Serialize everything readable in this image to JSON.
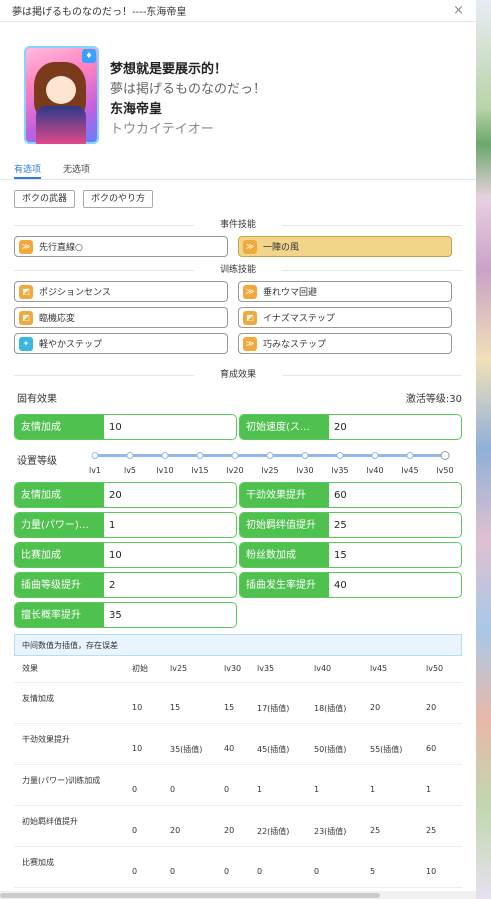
{
  "window": {
    "title": "夢は掲げるものなのだっ！----东海帝皇",
    "close": "×"
  },
  "card": {
    "badge": "♦"
  },
  "names": {
    "chinese_title": "梦想就是要展示的！",
    "japanese_title": "夢は掲げるものなのだっ！",
    "chinese_name": "东海帝皇",
    "japanese_name": "トウカイテイオー"
  },
  "tabs": [
    {
      "label": "有选项",
      "active": true
    },
    {
      "label": "无选项",
      "active": false
    }
  ],
  "options": [
    "ボクの武器",
    "ボクのやり方"
  ],
  "event_skills": {
    "header": "事件技能",
    "items": [
      {
        "label": "先行直線○",
        "style": "normal",
        "icon": "yellow"
      },
      {
        "label": "一陣の風",
        "style": "gold",
        "icon": "yellow"
      }
    ]
  },
  "training_skills": {
    "header": "训练技能",
    "items": [
      {
        "label": "ポジションセンス",
        "icon": "yellow"
      },
      {
        "label": "垂れウマ回避",
        "icon": "yellow"
      },
      {
        "label": "臨機応変",
        "icon": "yellow"
      },
      {
        "label": "イナズマステップ",
        "icon": "yellow"
      },
      {
        "label": "軽やかステップ",
        "icon": "blue"
      },
      {
        "label": "巧みなステップ",
        "icon": "yellow"
      }
    ]
  },
  "training_effects": {
    "header": "育成效果",
    "unique_label": "固有效果",
    "activation_level": "激活等级:30",
    "unique": [
      {
        "label": "友情加成",
        "value": "10"
      },
      {
        "label": "初始速度(ス…",
        "value": "20"
      }
    ],
    "level_label": "设置等级",
    "levels": [
      "lv1",
      "lv5",
      "lv10",
      "lv15",
      "lv20",
      "lv25",
      "lv30",
      "lv35",
      "lv40",
      "lv45",
      "lv50"
    ],
    "selected_level": "lv50",
    "stats": [
      {
        "label": "友情加成",
        "value": "20"
      },
      {
        "label": "干劲效果提升",
        "value": "60"
      },
      {
        "label": "力量(パワー)…",
        "value": "1"
      },
      {
        "label": "初始羁绊值提升",
        "value": "25"
      },
      {
        "label": "比赛加成",
        "value": "10"
      },
      {
        "label": "粉丝数加成",
        "value": "15"
      },
      {
        "label": "插曲等级提升",
        "value": "2"
      },
      {
        "label": "插曲发生率提升",
        "value": "40"
      },
      {
        "label": "擅长概率提升",
        "value": "35"
      }
    ]
  },
  "note": "中间数值为插值，存在误差",
  "table": {
    "headers": [
      "效果",
      "初始",
      "lv25",
      "lv30",
      "lv35",
      "lv40",
      "lv45",
      "lv50"
    ],
    "rows": [
      [
        "友情加成",
        "10",
        "15",
        "15",
        "17(插值)",
        "18(插值)",
        "20",
        "20"
      ],
      [
        "干劲效果提升",
        "10",
        "35(插值)",
        "40",
        "45(插值)",
        "50(插值)",
        "55(插值)",
        "60"
      ],
      [
        "力量(パワー)训练加成",
        "0",
        "0",
        "0",
        "1",
        "1",
        "1",
        "1"
      ],
      [
        "初始羁绊值提升",
        "0",
        "20",
        "20",
        "22(插值)",
        "23(插值)",
        "25",
        "25"
      ],
      [
        "比赛加成",
        "0",
        "0",
        "0",
        "0",
        "0",
        "5",
        "10"
      ]
    ]
  }
}
